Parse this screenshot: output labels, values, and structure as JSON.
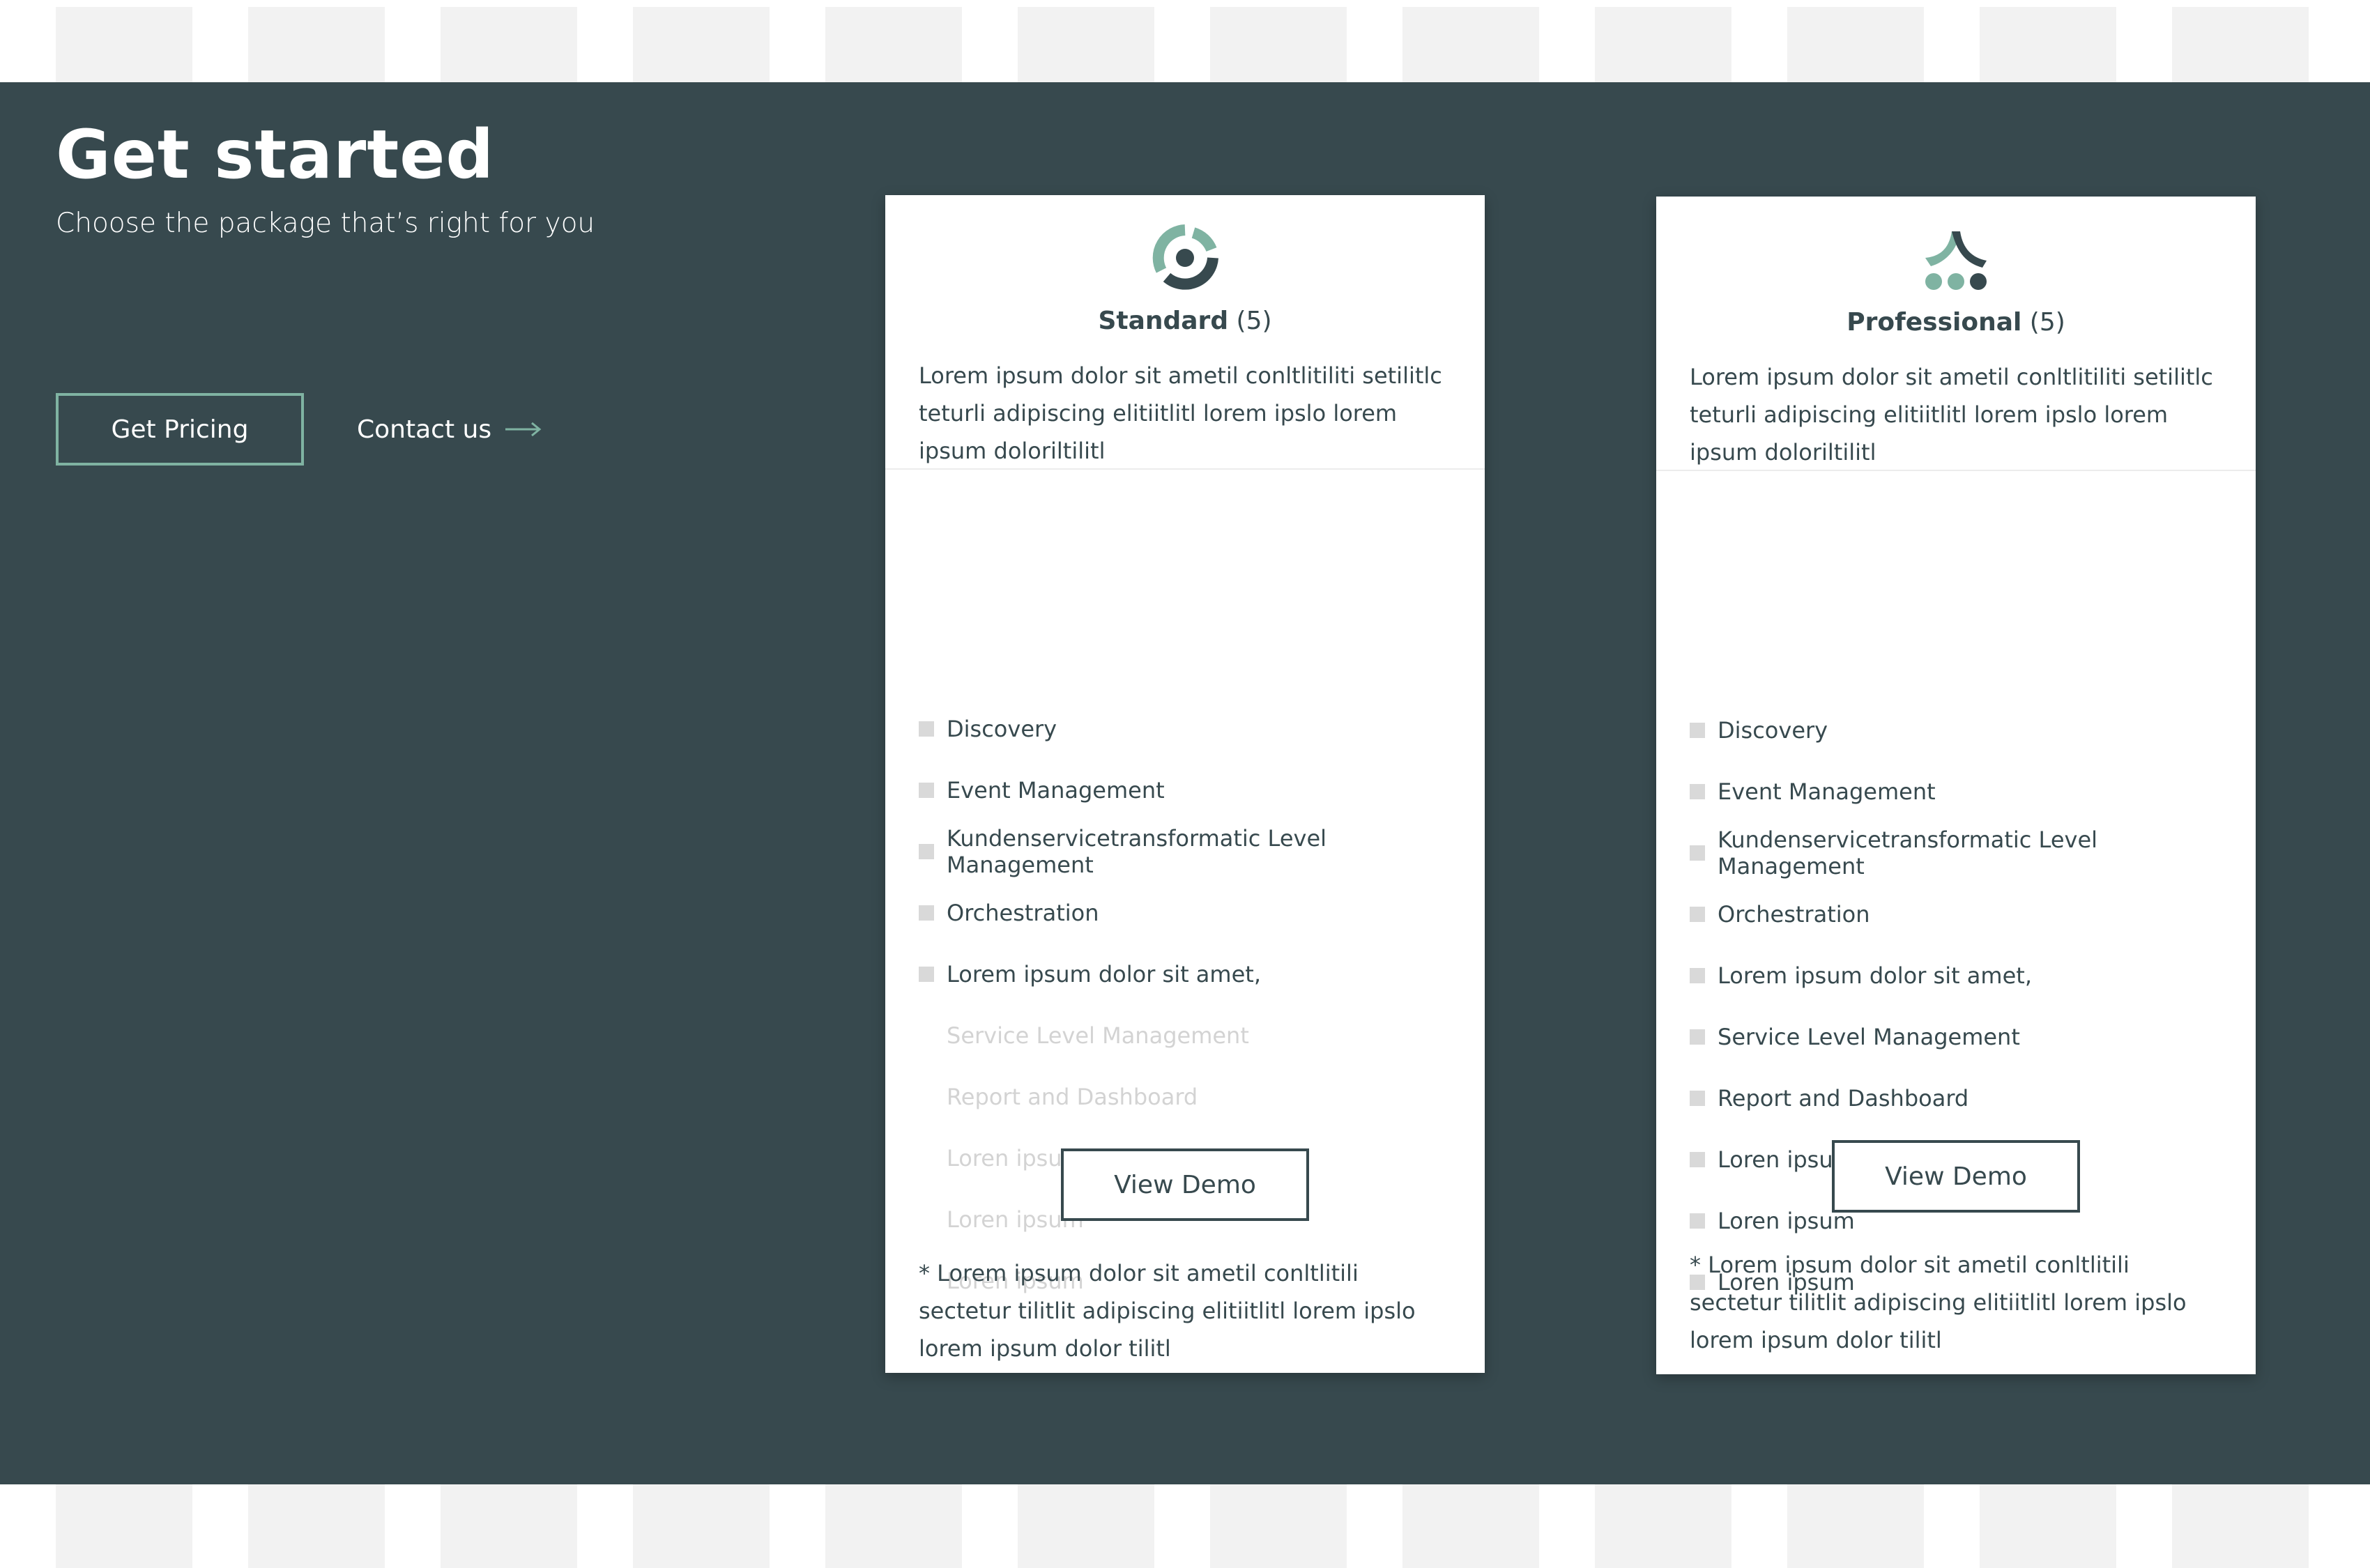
{
  "colors": {
    "band": "#37494e",
    "accent": "#7fb3a2",
    "text_dark": "#37494e",
    "muted": "#d3d3d3",
    "stripe": "#f2f2f2"
  },
  "hero": {
    "title": "Get started",
    "subtitle": "Choose the package that’s right for you",
    "primary_button": "Get Pricing",
    "contact_link": "Contact us",
    "contact_icon": "arrow-right-icon"
  },
  "cards": [
    {
      "icon": "target-ring-icon",
      "name": "Standard",
      "count": "(5)",
      "description": "Lorem ipsum dolor sit ametil conltlitiliti setilitlc teturli adipiscing elitiitlitl lorem ipslo lorem ipsum doloriltilitl",
      "features": [
        {
          "label": "Discovery",
          "included": true
        },
        {
          "label": "Event Management",
          "included": true
        },
        {
          "label": "Kundenservicetransformatic Level Management",
          "included": true
        },
        {
          "label": "Orchestration",
          "included": true
        },
        {
          "label": "Lorem ipsum dolor sit amet,",
          "included": true
        },
        {
          "label": "Service Level Management",
          "included": false
        },
        {
          "label": "Report and Dashboard",
          "included": false
        },
        {
          "label": "Loren ipsum",
          "included": false
        },
        {
          "label": "Loren ipsum",
          "included": false
        },
        {
          "label": "Loren ipsum",
          "included": false
        }
      ],
      "button": "View Demo",
      "note": "* Lorem ipsum dolor sit ametil conltlitili sectetur tilitlit adipiscing elitiitlitl lorem ipslo lorem ipsum dolor tilitl"
    },
    {
      "icon": "people-group-icon",
      "name": "Professional",
      "count": "(5)",
      "description": "Lorem ipsum dolor sit ametil conltlitiliti setilitlc teturli adipiscing elitiitlitl lorem ipslo lorem ipsum doloriltilitl",
      "features": [
        {
          "label": "Discovery",
          "included": true
        },
        {
          "label": "Event Management",
          "included": true
        },
        {
          "label": "Kundenservicetransformatic Level Management",
          "included": true
        },
        {
          "label": "Orchestration",
          "included": true
        },
        {
          "label": "Lorem ipsum dolor sit amet,",
          "included": true
        },
        {
          "label": "Service Level Management",
          "included": true
        },
        {
          "label": "Report and Dashboard",
          "included": true
        },
        {
          "label": "Loren ipsum",
          "included": true
        },
        {
          "label": "Loren ipsum",
          "included": true
        },
        {
          "label": "Loren ipsum",
          "included": true
        }
      ],
      "button": "View Demo",
      "note": "* Lorem ipsum dolor sit ametil conltlitili sectetur tilitlit adipiscing elitiitlitl lorem ipslo lorem ipsum dolor tilitl"
    }
  ]
}
